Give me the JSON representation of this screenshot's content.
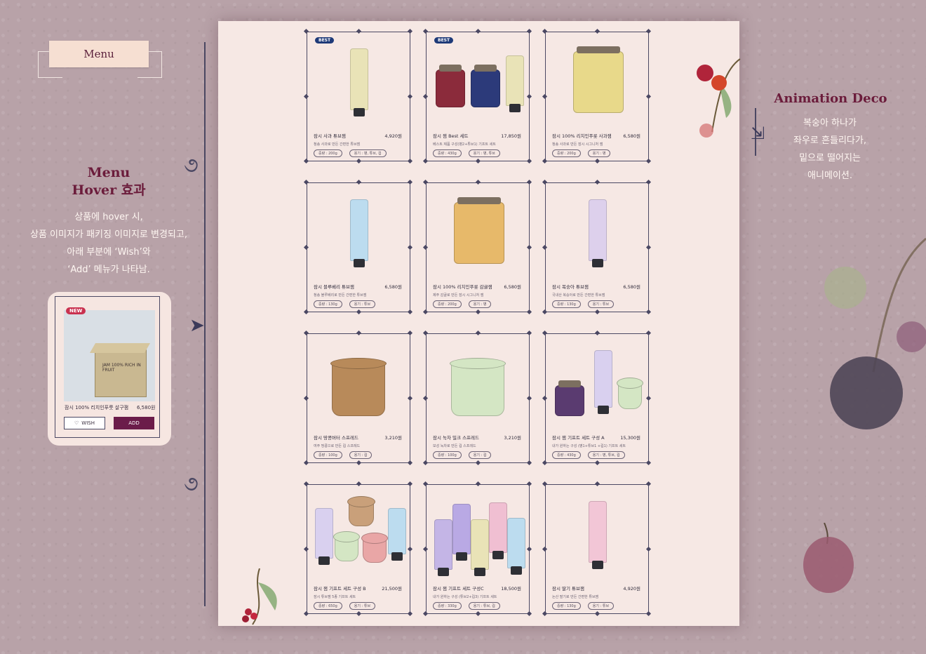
{
  "left_panel": {
    "menu_tag": "Menu",
    "title_line1": "Menu",
    "title_line2": "Hover 효과",
    "desc": [
      "상품에 hover 시,",
      "상품 이미지가 패키징 이미지로 변경되고,",
      "아래 부분에 ‘Wish’와",
      "‘Add’ 메뉴가 나타남."
    ],
    "hover_card": {
      "badge": "NEW",
      "box_label": "JAM 100% RICH IN FRUIT",
      "name": "잠시 100% 리치인푸룻 살구잼",
      "price": "6,580원",
      "wish_label": "WISH",
      "add_label": "ADD"
    }
  },
  "right_panel": {
    "title": "Animation Deco",
    "desc": [
      "복숭아 하나가",
      "좌우로 흔들리다가,",
      "밑으로 떨어지는",
      "애니메이션."
    ]
  },
  "products": [
    {
      "badge": "BEST",
      "name": "잠시 사과 튜브잼",
      "price": "4,920원",
      "desc": "청송 사과로 만든 간편한 튜브잼",
      "tags": [
        "중량 : 200g",
        "용기 : 병, 튜브, 컵"
      ],
      "kind": "tube",
      "color": "#e9e3b7"
    },
    {
      "badge": "BEST",
      "name": "잠시 잼 Best 세트",
      "price": "17,850원",
      "desc": "베스트 제품 구성(병2+튜브1) 기프트 세트",
      "tags": [
        "중량 : 430g",
        "용기 : 병, 튜브"
      ],
      "kind": "set1",
      "color": "#8b2b3b"
    },
    {
      "badge": "",
      "name": "잠시 100% 리치인푸룻 사과잼",
      "price": "6,580원",
      "desc": "청송 사과로 만든 잠시 시그니처 잼",
      "tags": [
        "중량 : 200g",
        "용기 : 병"
      ],
      "kind": "jar",
      "color": "#e8d98a"
    },
    {
      "badge": "",
      "name": "잠시 블루베리 튜브잼",
      "price": "6,580원",
      "desc": "청송 블루베리로 만든 간편한 튜브잼",
      "tags": [
        "중량 : 130g",
        "용기 : 튜브"
      ],
      "kind": "tube",
      "color": "#bcdcef"
    },
    {
      "badge": "",
      "name": "잠시 100% 리치인푸룻 감귤잼",
      "price": "6,580원",
      "desc": "제주 감귤로 만든 잠시 시그니처 잼",
      "tags": [
        "중량 : 200g",
        "용기 : 병"
      ],
      "kind": "jar",
      "color": "#e7b96a"
    },
    {
      "badge": "",
      "name": "잠시 복숭아 튜브잼",
      "price": "6,580원",
      "desc": "국내산 복숭아로 만든 간편한 튜브잼",
      "tags": [
        "중량 : 130g",
        "용기 : 튜브"
      ],
      "kind": "tube",
      "color": "#ddd0ec"
    },
    {
      "badge": "",
      "name": "잠시 땅콩버터 스프레드",
      "price": "3,210원",
      "desc": "여주 땅콩으로 만든 컵 스프레드",
      "tags": [
        "중량 : 100g",
        "용기 : 컵"
      ],
      "kind": "cup",
      "color": "#b88a5a"
    },
    {
      "badge": "",
      "name": "잠시 녹차 밀크 스프레드",
      "price": "3,210원",
      "desc": "보성 녹차로 만든 컵 스프레드",
      "tags": [
        "중량 : 100g",
        "용기 : 컵"
      ],
      "kind": "cup",
      "color": "#d4e6c4"
    },
    {
      "badge": "",
      "name": "잠시 잼 기프트 세트 구성 A",
      "price": "15,300원",
      "desc": "내가 원하는 구성 (병1+튜브1 +컵1) 기프트 세트",
      "tags": [
        "중량 : 430g",
        "용기 : 병, 튜브, 컵"
      ],
      "kind": "setA",
      "color": "#5a3b70"
    },
    {
      "badge": "",
      "name": "잠시 잼 기프트 세트 구성 B",
      "price": "21,500원",
      "desc": "잠시 튜브잼 5종 기프트 세트",
      "tags": [
        "중량 : 650g",
        "용기 : 튜브"
      ],
      "kind": "setB",
      "color": "#c9a07a"
    },
    {
      "badge": "",
      "name": "잠시 잼 기프트 세트 구성C",
      "price": "18,500원",
      "desc": "내가 원하는 구성 (튜브2+컵3) 기프트 세트",
      "tags": [
        "중량 : 330g",
        "용기 : 튜브, 컵"
      ],
      "kind": "setC",
      "color": "#c4b5e6"
    },
    {
      "badge": "",
      "name": "잠시 딸기 튜브잼",
      "price": "4,920원",
      "desc": "논산 딸기로 만든 간편한 튜브잼",
      "tags": [
        "중량 : 130g",
        "용기 : 튜브"
      ],
      "kind": "tube",
      "color": "#f2c6d6"
    }
  ]
}
